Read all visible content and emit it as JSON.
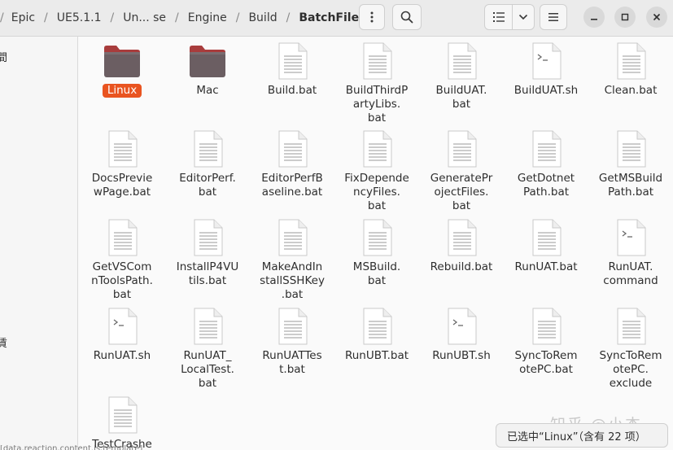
{
  "breadcrumb": {
    "items": [
      "Epic",
      "UE5.1.1",
      "Un... se",
      "Engine",
      "Build"
    ],
    "current": "BatchFiles"
  },
  "sidebar": {
    "items": [
      "間",
      "賃"
    ]
  },
  "files": [
    {
      "label": "Linux",
      "type": "folder",
      "selected": true
    },
    {
      "label": "Mac",
      "type": "folder"
    },
    {
      "label": "Build.bat",
      "type": "text"
    },
    {
      "label": "BuildThirdP\nartyLibs.\nbat",
      "type": "text"
    },
    {
      "label": "BuildUAT.\nbat",
      "type": "text"
    },
    {
      "label": "BuildUAT.sh",
      "type": "script"
    },
    {
      "label": "Clean.bat",
      "type": "text"
    },
    {
      "label": "DocsPrevie\nwPage.bat",
      "type": "text"
    },
    {
      "label": "EditorPerf.\nbat",
      "type": "text"
    },
    {
      "label": "EditorPerfB\naseline.bat",
      "type": "text"
    },
    {
      "label": "FixDepende\nncyFiles.\nbat",
      "type": "text"
    },
    {
      "label": "GeneratePr\nojectFiles.\nbat",
      "type": "text"
    },
    {
      "label": "GetDotnet\nPath.bat",
      "type": "text"
    },
    {
      "label": "GetMSBuild\nPath.bat",
      "type": "text"
    },
    {
      "label": "GetVSCom\nnToolsPath.\nbat",
      "type": "text"
    },
    {
      "label": "InstallP4VU\ntils.bat",
      "type": "text"
    },
    {
      "label": "MakeAndIn\nstallSSHKey\n.bat",
      "type": "text"
    },
    {
      "label": "MSBuild.\nbat",
      "type": "text"
    },
    {
      "label": "Rebuild.bat",
      "type": "text"
    },
    {
      "label": "RunUAT.bat",
      "type": "text"
    },
    {
      "label": "RunUAT.\ncommand",
      "type": "script"
    },
    {
      "label": "RunUAT.sh",
      "type": "script"
    },
    {
      "label": "RunUAT_\nLocalTest.\nbat",
      "type": "text"
    },
    {
      "label": "RunUATTes\nt.bat",
      "type": "text"
    },
    {
      "label": "RunUBT.bat",
      "type": "text"
    },
    {
      "label": "RunUBT.sh",
      "type": "script"
    },
    {
      "label": "SyncToRem\notePC.bat",
      "type": "text"
    },
    {
      "label": "SyncToRem\notePC.\nexclude",
      "type": "text"
    },
    {
      "label": "TestCrashe",
      "type": "text"
    }
  ],
  "status": {
    "text": "已选中“Linux”（含有 22 项）"
  },
  "watermark": "知乎 @小杰",
  "bottom_text": "[data,reaction,content.js,template]",
  "colors": {
    "accent": "#e95420",
    "folder": "#6b5e62",
    "folder_tab": "#a83c3c"
  },
  "icons": {
    "menu_button": "kebab-icon",
    "search_button": "search-icon",
    "view_button": "list-view-icon",
    "view_options": "chevron-down-icon",
    "main_menu": "hamburger-icon",
    "minimize": "minimize-icon",
    "maximize": "maximize-icon",
    "close": "close-icon"
  }
}
